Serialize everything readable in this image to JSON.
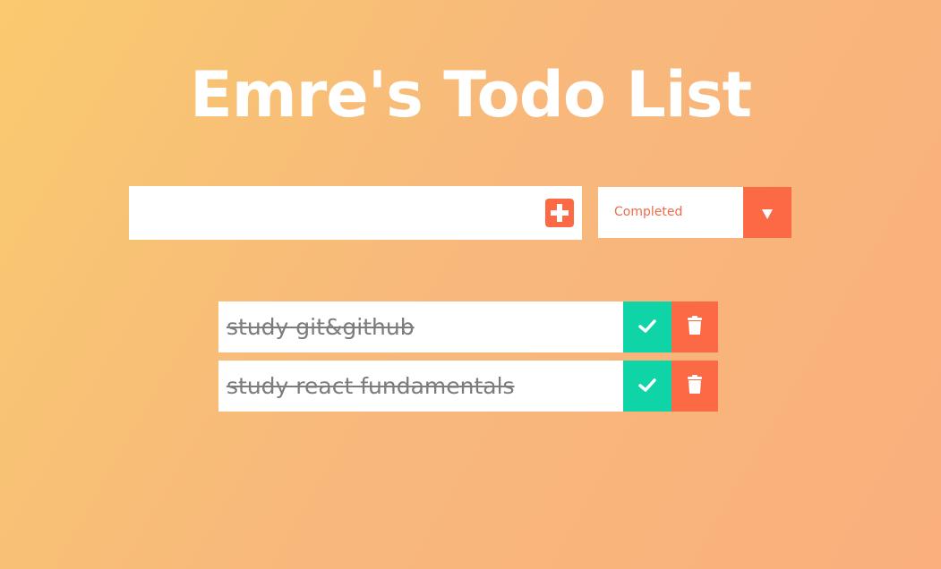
{
  "app": {
    "title": "Emre's Todo List"
  },
  "form": {
    "input_value": "",
    "input_placeholder": "",
    "add_icon": "plus-square-icon",
    "filter": {
      "selected": "Completed",
      "arrow_icon": "caret-down-icon"
    }
  },
  "todos": [
    {
      "text": "study git&github",
      "completed": true
    },
    {
      "text": "study react fundamentals",
      "completed": true
    }
  ],
  "colors": {
    "accent": "#fb6a45",
    "complete": "#0fd4a7",
    "gradient_start": "#f9ca6f",
    "gradient_end": "#faaf7c"
  }
}
